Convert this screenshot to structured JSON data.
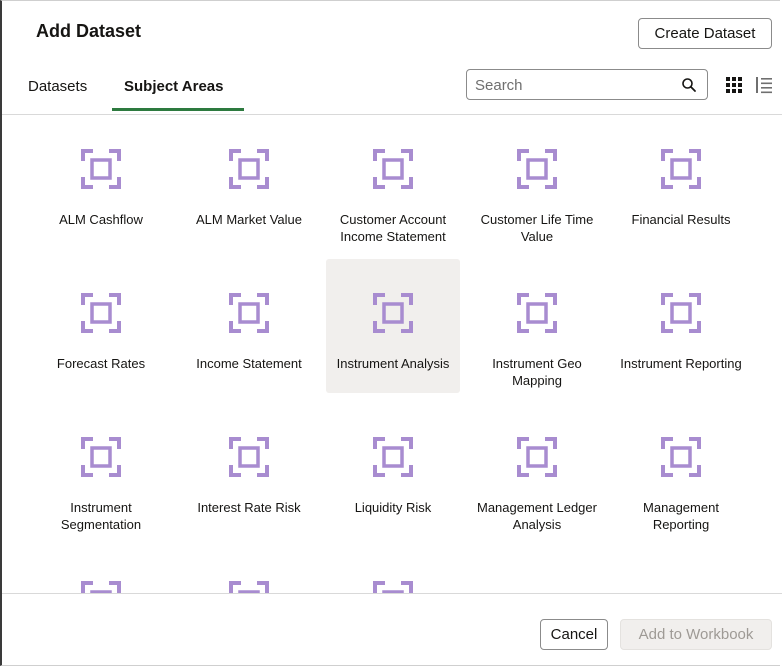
{
  "dialog": {
    "title": "Add Dataset",
    "create_button": "Create Dataset"
  },
  "tabs": [
    {
      "label": "Datasets",
      "active": false
    },
    {
      "label": "Subject Areas",
      "active": true
    }
  ],
  "search": {
    "placeholder": "Search",
    "value": ""
  },
  "view_toggle": {
    "grid_icon": "grid-view-icon",
    "list_icon": "list-view-icon",
    "selected": "grid"
  },
  "subject_areas": [
    {
      "label": "ALM Cashflow"
    },
    {
      "label": "ALM Market Value"
    },
    {
      "label": "Customer Account Income Statement"
    },
    {
      "label": "Customer Life Time Value"
    },
    {
      "label": "Financial Results"
    },
    {
      "label": "Forecast Rates"
    },
    {
      "label": "Income Statement"
    },
    {
      "label": "Instrument Analysis",
      "selected": true
    },
    {
      "label": "Instrument Geo Mapping"
    },
    {
      "label": "Instrument Reporting"
    },
    {
      "label": "Instrument Segmentation"
    },
    {
      "label": "Interest Rate Risk"
    },
    {
      "label": "Liquidity Risk"
    },
    {
      "label": "Management Ledger Analysis"
    },
    {
      "label": "Management Reporting"
    },
    {
      "label": ""
    },
    {
      "label": ""
    },
    {
      "label": ""
    }
  ],
  "footer": {
    "cancel_label": "Cancel",
    "add_label": "Add to Workbook"
  },
  "colors": {
    "icon": "#a88cd0",
    "tab_underline": "#2d7a3f",
    "selected_tile": "#f1efed"
  }
}
